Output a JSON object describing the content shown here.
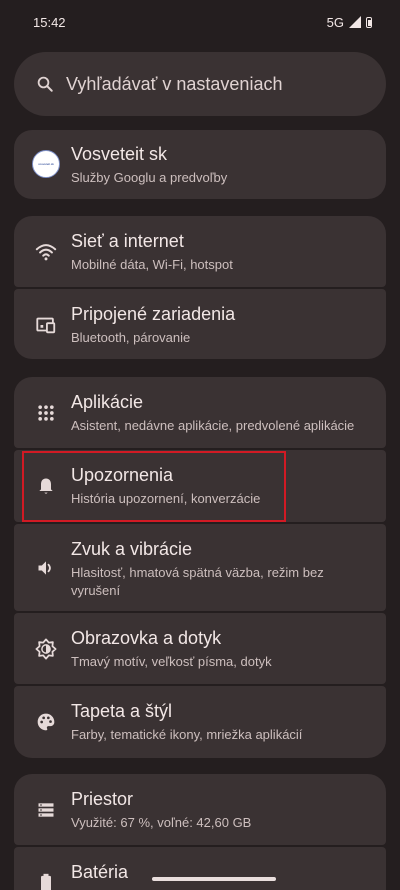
{
  "status_bar": {
    "time": "15:42",
    "network": "5G"
  },
  "search": {
    "text": "Vyhľadávať v nastaveniach"
  },
  "account": {
    "title": "Vosveteit sk",
    "subtitle": "Služby Googlu a predvoľby",
    "avatar_text": "vosveteit.sk"
  },
  "network_group": {
    "items": [
      {
        "title": "Sieť a internet",
        "subtitle": "Mobilné dáta, Wi-Fi, hotspot",
        "icon": "wifi-icon"
      },
      {
        "title": "Pripojené zariadenia",
        "subtitle": "Bluetooth, párovanie",
        "icon": "connected-devices-icon"
      }
    ]
  },
  "apps_group": {
    "items": [
      {
        "title": "Aplikácie",
        "subtitle": "Asistent, nedávne aplikácie, predvolené aplikácie",
        "icon": "apps-grid-icon"
      },
      {
        "title": "Upozornenia",
        "subtitle": "História upozornení, konverzácie",
        "icon": "bell-icon"
      },
      {
        "title": "Zvuk a vibrácie",
        "subtitle": "Hlasitosť, hmatová spätná väzba, režim bez vyrušení",
        "icon": "volume-icon"
      },
      {
        "title": "Obrazovka a dotyk",
        "subtitle": "Tmavý motív, veľkosť písma, dotyk",
        "icon": "brightness-icon"
      },
      {
        "title": "Tapeta a štýl",
        "subtitle": "Farby, tematické ikony, mriežka aplikácií",
        "icon": "palette-icon"
      }
    ]
  },
  "storage_group": {
    "items": [
      {
        "title": "Priestor",
        "subtitle": "Využité: 67 %, voľné: 42,60 GB",
        "icon": "storage-icon"
      },
      {
        "title": "Batéria",
        "subtitle": "",
        "icon": "battery-icon"
      }
    ]
  },
  "colors": {
    "background": "#241e1f",
    "card": "#3a3233",
    "highlight": "#d11a24"
  }
}
